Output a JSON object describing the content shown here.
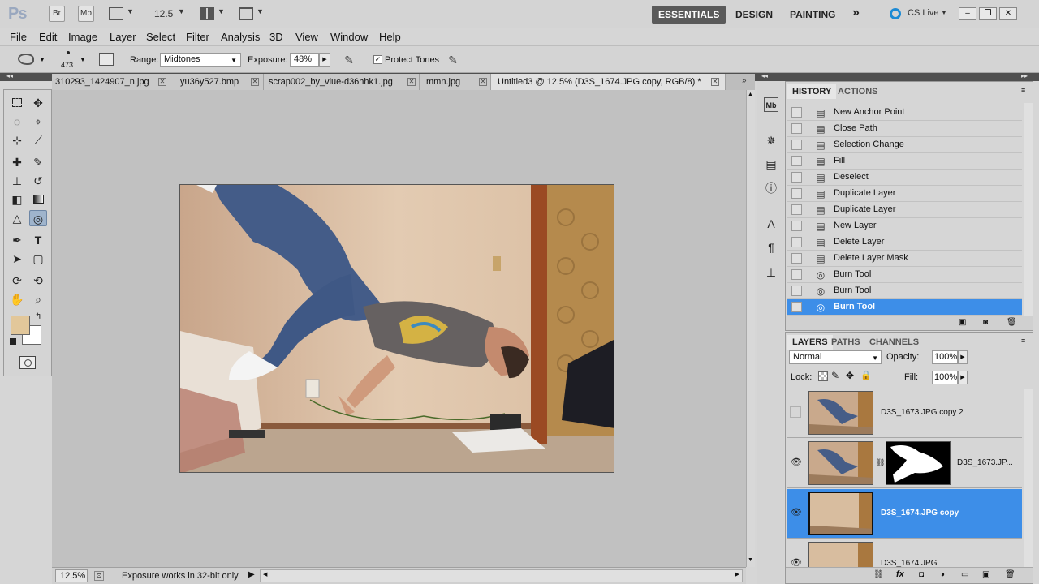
{
  "appbar": {
    "logo": "Ps",
    "br": "Br",
    "mb": "Mb",
    "zoom": "12.5",
    "workspaces": [
      "ESSENTIALS",
      "DESIGN",
      "PAINTING"
    ],
    "more": "»",
    "cslive": "CS Live"
  },
  "menu": [
    "File",
    "Edit",
    "Image",
    "Layer",
    "Select",
    "Filter",
    "Analysis",
    "3D",
    "View",
    "Window",
    "Help"
  ],
  "options": {
    "brush_size": "473",
    "range_label": "Range:",
    "range_value": "Midtones",
    "exposure_label": "Exposure:",
    "exposure_value": "48%",
    "protect_label": "Protect Tones"
  },
  "tabs": [
    {
      "label": "310293_1424907_n.jpg"
    },
    {
      "label": "yu36y527.bmp"
    },
    {
      "label": "scrap002_by_vlue-d36hhk1.jpg"
    },
    {
      "label": "mmn.jpg"
    },
    {
      "label": "Untitled3 @ 12.5% (D3S_1674.JPG copy, RGB/8) *"
    }
  ],
  "status": {
    "zoom": "12.5%",
    "message": "Exposure works in 32-bit only"
  },
  "history": {
    "tabs": [
      "HISTORY",
      "ACTIONS"
    ],
    "items": [
      "New Anchor Point",
      "Close Path",
      "Selection Change",
      "Fill",
      "Deselect",
      "Duplicate Layer",
      "Duplicate Layer",
      "New Layer",
      "Delete Layer",
      "Delete Layer Mask",
      "Burn Tool",
      "Burn Tool",
      "Burn Tool"
    ]
  },
  "layers": {
    "tabs": [
      "LAYERS",
      "PATHS",
      "CHANNELS"
    ],
    "blend_mode": "Normal",
    "opacity_label": "Opacity:",
    "opacity_value": "100%",
    "lock_label": "Lock:",
    "fill_label": "Fill:",
    "fill_value": "100%",
    "items": [
      {
        "name": "D3S_1673.JPG copy 2"
      },
      {
        "name": "D3S_1673.JP..."
      },
      {
        "name": "D3S_1674.JPG copy"
      },
      {
        "name": "D3S_1674.JPG"
      }
    ]
  },
  "colors": {
    "foreground": "#e2c79a",
    "background": "#ffffff",
    "selection": "#3d8ee8",
    "active_workspace": "#5a5a5a"
  }
}
